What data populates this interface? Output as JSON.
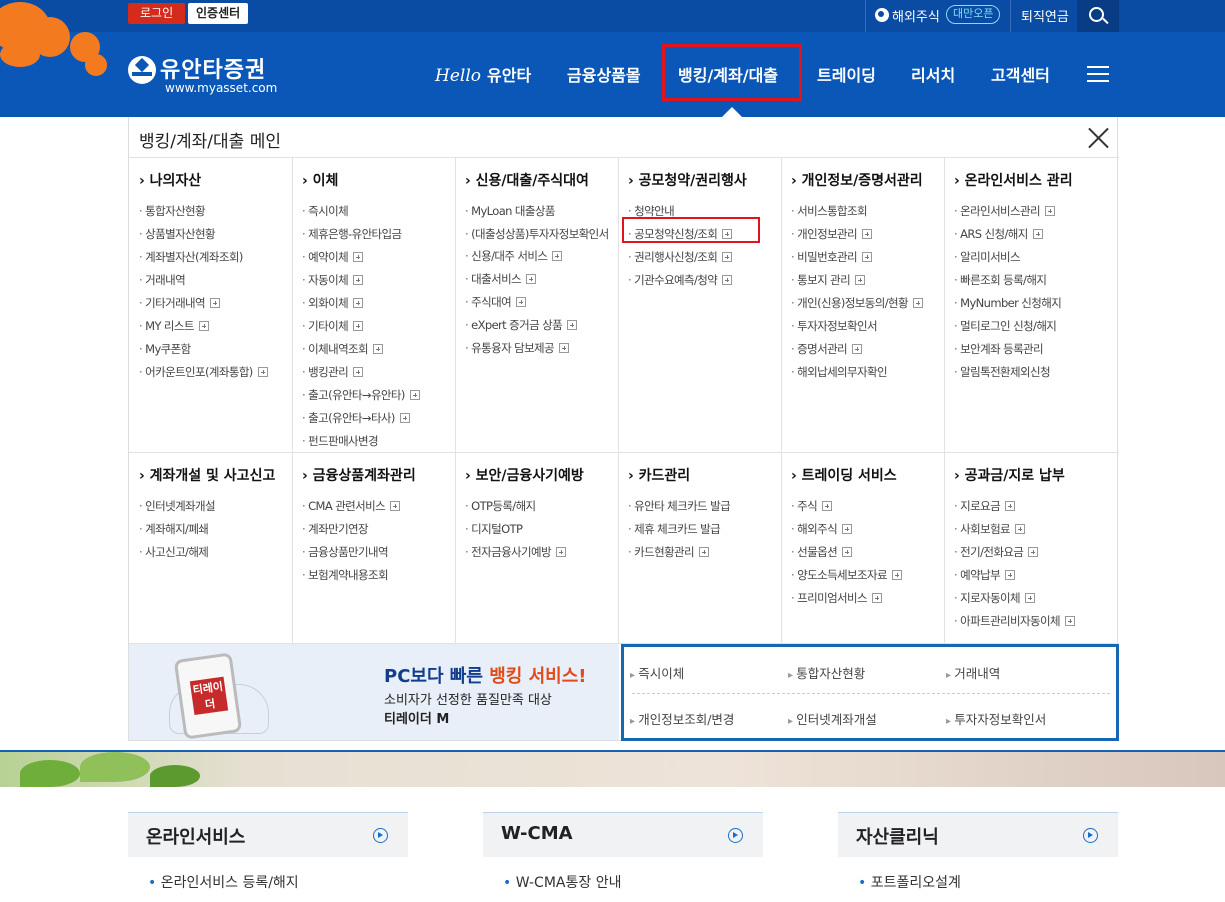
{
  "topbar": {
    "login": "로그인",
    "cert": "인증센터",
    "overseas": "해외주식",
    "taiwan": "대만오픈",
    "pension": "퇴직연금"
  },
  "header": {
    "logo": "유안타증권",
    "url": "www.myasset.com",
    "nav": [
      {
        "hello": "Hello",
        "label": "유안타"
      },
      {
        "label": "금융상품몰"
      },
      {
        "label": "뱅킹/계좌/대출"
      },
      {
        "label": "트레이딩"
      },
      {
        "label": "리서치"
      },
      {
        "label": "고객센터"
      }
    ]
  },
  "mega": {
    "title": "뱅킹/계좌/대출 메인",
    "columns": [
      {
        "head": "나의자산",
        "items": [
          "통합자산현황",
          "상품별자산현황",
          "계좌별자산(계좌조회)",
          "거래내역",
          "기타거래내역",
          "MY 리스트",
          "My쿠폰함",
          "어카운트인포(계좌통합)"
        ]
      },
      {
        "head": "이체",
        "items": [
          "즉시이체",
          "제휴은행-유안타입금",
          "예약이체",
          "자동이체",
          "외화이체",
          "기타이체",
          "이체내역조회",
          "뱅킹관리",
          "출고(유안타→유안타)",
          "출고(유안타→타사)",
          "펀드판매사변경"
        ]
      },
      {
        "head": "신용/대출/주식대여",
        "items": [
          "MyLoan 대출상품",
          "(대출성상품)투자자정보확인서",
          "신용/대주 서비스",
          "대출서비스",
          "주식대여",
          "eXpert 증거금 상품",
          "유통융자 담보제공"
        ]
      },
      {
        "head": "공모청약/권리행사",
        "items": [
          "청약안내",
          "공모청약신청/조회",
          "권리행사신청/조회",
          "기관수요예측/청약"
        ]
      },
      {
        "head": "개인정보/증명서관리",
        "items": [
          "서비스통합조회",
          "개인정보관리",
          "비밀번호관리",
          "통보지 관리",
          "개인(신용)정보동의/현황",
          "투자자정보확인서",
          "증명서관리",
          "해외납세의무자확인"
        ]
      },
      {
        "head": "온라인서비스 관리",
        "items": [
          "온라인서비스관리",
          "ARS 신청/해지",
          "알리미서비스",
          "빠른조회 등록/해지",
          "MyNumber 신청해지",
          "멀티로그인 신청/해지",
          "보안계좌 등록관리",
          "알림톡전환제외신청"
        ]
      },
      {
        "head": "계좌개설 및 사고신고",
        "items": [
          "인터넷계좌개설",
          "계좌해지/폐쇄",
          "사고신고/해제"
        ]
      },
      {
        "head": "금융상품계좌관리",
        "items": [
          "CMA 관련서비스",
          "계좌만기연장",
          "금융상품만기내역",
          "보험계약내용조회"
        ]
      },
      {
        "head": "보안/금융사기예방",
        "items": [
          "OTP등록/해지",
          "디지털OTP",
          "전자금융사기예방"
        ]
      },
      {
        "head": "카드관리",
        "items": [
          "유안타 체크카드 발급",
          "제휴 체크카드 발급",
          "카드현황관리"
        ]
      },
      {
        "head": "트레이딩 서비스",
        "items": [
          "주식",
          "해외주식",
          "선물옵션",
          "양도소득세보조자료",
          "프리미엄서비스"
        ]
      },
      {
        "head": "공과금/지로 납부",
        "items": [
          "지로요금",
          "사회보험료",
          "전기/전화요금",
          "예약납부",
          "지로자동이체",
          "아파트관리비자동이체"
        ]
      }
    ]
  },
  "promo": {
    "head_pre": "PC보다 빠른 ",
    "head_hl": "뱅킹 서비스!",
    "sub": "소비자가 선정한 품질만족 대상",
    "brand": "티레이더 M",
    "phone_logo": "티레이더"
  },
  "quick": [
    "즉시이체",
    "통합자산현황",
    "거래내역",
    "개인정보조회/변경",
    "인터넷계좌개설",
    "투자자정보확인서"
  ],
  "cards": [
    {
      "title": "온라인서비스",
      "item": "온라인서비스 등록/해지"
    },
    {
      "title": "W-CMA",
      "item": "W-CMA통장 안내"
    },
    {
      "title": "자산클리닉",
      "item": "포트폴리오설계"
    }
  ]
}
